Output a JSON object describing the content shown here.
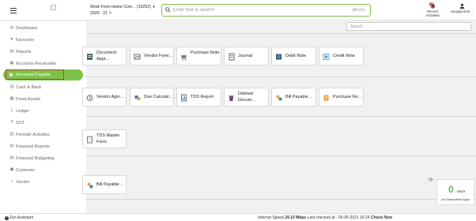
{
  "header": {
    "company_line1": "Work From Home Com... (10252)",
    "company_line2": "2020 - 21",
    "search_placeholder": "Enter text to search",
    "search_shortcut": "[Alt+G]",
    "recent_label": "Recent Activities",
    "recent_count": "0",
    "user_label": "anujagl.shin..."
  },
  "sidebar": {
    "items": [
      {
        "label": "Dashboard",
        "icon": "dashboard-icon"
      },
      {
        "label": "Favourite",
        "icon": "heart-icon"
      },
      {
        "label": "Reports",
        "icon": "reports-icon"
      },
      {
        "label": "Accounts Receivable",
        "icon": "receivable-icon"
      },
      {
        "label": "Accounts Payable",
        "icon": "payable-icon"
      },
      {
        "label": "Cash & Bank",
        "icon": "bank-icon"
      },
      {
        "label": "Fixed Assets",
        "icon": "assets-icon"
      },
      {
        "label": "Ledger",
        "icon": "ledger-icon"
      },
      {
        "label": "GST",
        "icon": "rupee-icon"
      },
      {
        "label": "Periodic Activities",
        "icon": "periodic-icon"
      },
      {
        "label": "Financial Reports",
        "icon": "financial-reports-icon"
      },
      {
        "label": "Financial Budgeting",
        "icon": "budget-icon"
      },
      {
        "label": "Customer",
        "icon": "customer-icon"
      },
      {
        "label": "Vendor",
        "icon": "vendor-icon"
      }
    ],
    "active": "Accounts Payable"
  },
  "content": {
    "search_placeholder": "Search",
    "row1": [
      {
        "label": "Document Appr...",
        "icon": "document-approval-icon"
      },
      {
        "label": "Vendor Foreig...",
        "icon": "vendor-foreign-icon"
      },
      {
        "label": "Purchase Note",
        "icon": "purchase-note-icon"
      },
      {
        "label": "Journal",
        "icon": "journal-icon"
      },
      {
        "label": "Debit Note",
        "icon": "debit-note-icon"
      },
      {
        "label": "Credit Note",
        "icon": "credit-note-icon"
      }
    ],
    "row2": [
      {
        "label": "Vendor Aging...",
        "icon": "vendor-aging-icon"
      },
      {
        "label": "Due Calculati...",
        "icon": "due-calculation-icon"
      },
      {
        "label": "TDS Report",
        "icon": "tds-report-icon"
      },
      {
        "label": "Deleted Docum...",
        "icon": "deleted-document-icon"
      },
      {
        "label": "Bill Payable ...",
        "icon": "bill-payable-icon"
      },
      {
        "label": "Purchase Regi...",
        "icon": "purchase-register-icon"
      }
    ],
    "row3": [
      {
        "label": "TDS Master Form",
        "icon": "tds-master-icon"
      }
    ],
    "row4": [
      {
        "label": "Bill Payable ...",
        "icon": "bill-payable-icon"
      }
    ]
  },
  "widget": {
    "count": "0",
    "more": "More",
    "label": "Un-Subscribed Apps"
  },
  "status": {
    "assistant": "Zen Assistant",
    "speed_prefix": "Internet Speed",
    "speed_value": "24.10 Mbps",
    "checked": "Last checked at - 05-05-2021 16:24",
    "check_now": "Check Now"
  },
  "colors": {
    "accent": "#7cc24a",
    "active_outline": "#d9352b",
    "badge": "#e23b3b",
    "widget_number": "#5cb85c"
  }
}
